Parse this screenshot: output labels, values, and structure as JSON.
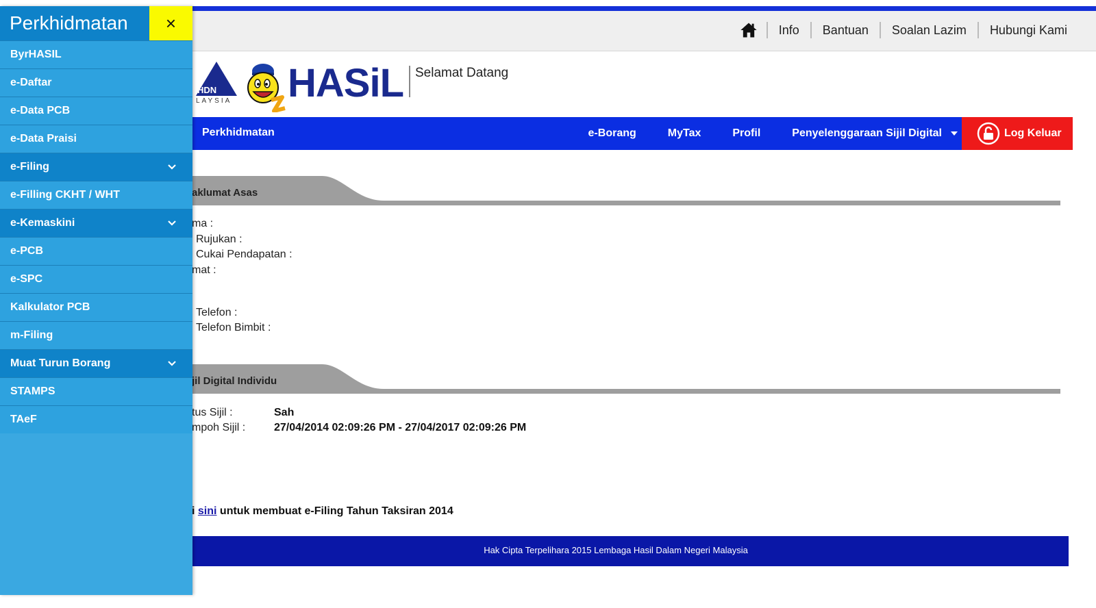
{
  "topbar": {
    "links": [
      "Info",
      "Bantuan",
      "Soalan Lazim",
      "Hubungi Kami"
    ]
  },
  "brand": {
    "hdn_text": "HDN",
    "laysia_text": "LAYSIA",
    "logo_text": "HASiL",
    "welcome": "Selamat Datang"
  },
  "nav": {
    "left": "Perkhidmatan",
    "items": [
      "e-Borang",
      "MyTax",
      "Profil",
      "Penyelenggaraan Sijil Digital"
    ],
    "logout": "Log Keluar"
  },
  "section1": {
    "title": "aklumat Asas",
    "fields": [
      "ma :",
      "Rujukan :",
      "Cukai Pendapatan :",
      "mat :",
      "Telefon :",
      "Telefon Bimbit :"
    ]
  },
  "section2": {
    "title": "jil Digital Individu",
    "fields": [
      {
        "label": "tus Sijil :",
        "value": "Sah"
      },
      {
        "label": "mpoh Sijil :",
        "value": "27/04/2014 02:09:26 PM - 27/04/2017 02:09:26 PM"
      }
    ]
  },
  "note": {
    "prefix": "i",
    "link": "sini",
    "suffix": "untuk membuat e-Filing Tahun Taksiran 2014"
  },
  "footer": {
    "text": "Hak Cipta Terpelihara 2015 Lembaga Hasil Dalam Negeri Malaysia"
  },
  "sidebar": {
    "title": "Perkhidmatan",
    "close": "×",
    "items": [
      {
        "label": "ByrHASIL",
        "expandable": false
      },
      {
        "label": "e-Daftar",
        "expandable": false
      },
      {
        "label": "e-Data PCB",
        "expandable": false
      },
      {
        "label": "e-Data Praisi",
        "expandable": false
      },
      {
        "label": "e-Filing",
        "expandable": true
      },
      {
        "label": "e-Filling CKHT / WHT",
        "expandable": false
      },
      {
        "label": "e-Kemaskini",
        "expandable": true
      },
      {
        "label": "e-PCB",
        "expandable": false
      },
      {
        "label": "e-SPC",
        "expandable": false
      },
      {
        "label": "Kalkulator PCB",
        "expandable": false
      },
      {
        "label": "m-Filing",
        "expandable": false
      },
      {
        "label": "Muat Turun Borang",
        "expandable": true
      },
      {
        "label": "STAMPS",
        "expandable": false
      },
      {
        "label": "TAeF",
        "expandable": false
      }
    ]
  },
  "colors": {
    "nav": "#0b2ee2",
    "logout": "#ee1a1a",
    "sidebar": "#3aa8e1",
    "sidebar_dark": "#0f83c9",
    "close_btn": "#fafa00",
    "footer": "#0a17a7"
  },
  "icons": {
    "home": "home-icon",
    "lock": "lock-icon",
    "close": "close-icon",
    "chevron": "chevron-down-icon"
  }
}
